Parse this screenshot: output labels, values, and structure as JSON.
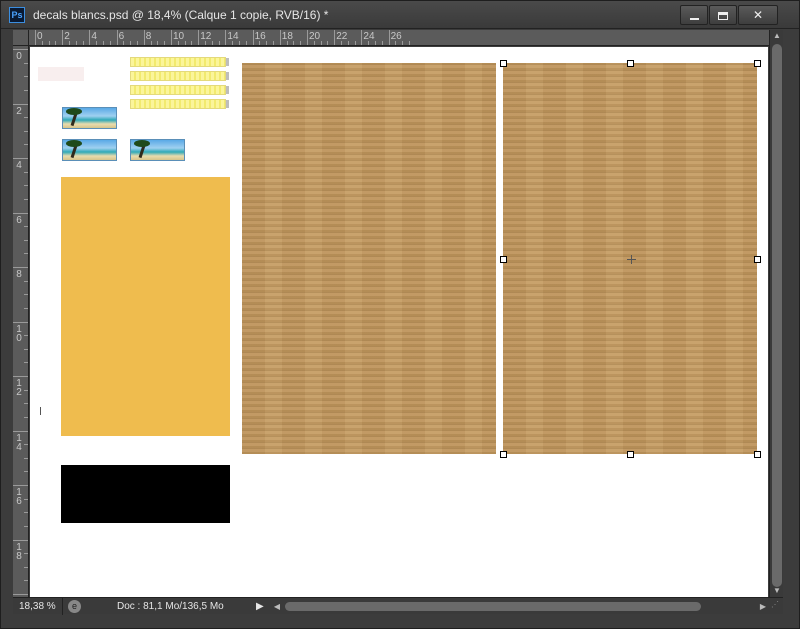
{
  "window": {
    "title": "decals blancs.psd @ 18,4% (Calque 1 copie, RVB/16) *",
    "app_logo": "Ps",
    "controls": {
      "minimize_icon": "minimize-icon",
      "maximize_icon": "maximize-icon",
      "close_icon": "close-icon",
      "close_glyph": "✕"
    }
  },
  "ruler_h": [
    "0",
    "2",
    "4",
    "6",
    "8",
    "10",
    "12",
    "14",
    "16",
    "18",
    "20",
    "22",
    "24",
    "26"
  ],
  "ruler_v": [
    "0",
    "2",
    "4",
    "6",
    "8",
    "1 0",
    "1 2",
    "1 4",
    "1 6",
    "1 8",
    "2"
  ],
  "canvas": {
    "background": "#ffffff",
    "colors": {
      "orange": "#efbc4e",
      "black": "#000000",
      "wood": "#c4995e",
      "yellow": "#fbf59a"
    }
  },
  "status": {
    "zoom": "18,38 %",
    "doc_info": "Doc : 81,1 Mo/136,5 Mo",
    "expand_arrow": "▶"
  },
  "scrollbars": {
    "up_arrow": "▲",
    "down_arrow": "▼",
    "left_arrow": "◀",
    "right_arrow": "▶"
  }
}
